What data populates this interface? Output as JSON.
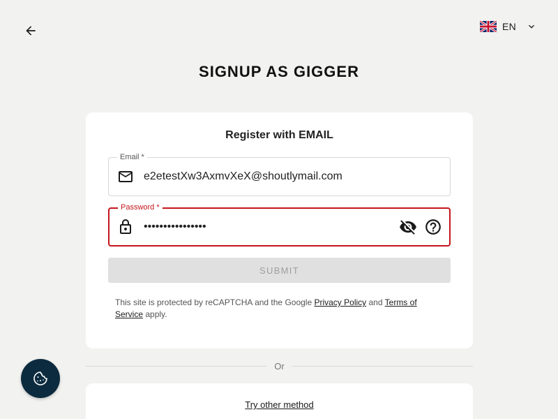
{
  "header": {
    "back_icon": "arrow-left-icon",
    "language": {
      "code": "EN",
      "flag_icon": "uk-flag-icon",
      "chevron_icon": "chevron-down-icon"
    }
  },
  "title": "SIGNUP AS GIGGER",
  "form": {
    "heading": "Register with EMAIL",
    "email": {
      "label": "Email *",
      "value": "e2etestXw3AxmvXeX@shoutlymail.com",
      "icon": "mail-icon"
    },
    "password": {
      "label": "Password *",
      "value": "••••••••••••••••",
      "icon": "lock-icon",
      "visibility_icon": "eye-off-icon",
      "help_icon": "help-circle-icon"
    },
    "submit_label": "SUBMIT",
    "captcha": {
      "prefix": "This site is protected by reCAPTCHA and the Google ",
      "privacy_link": "Privacy Policy",
      "middle": " and ",
      "terms_link": "Terms of Service",
      "suffix": " apply."
    }
  },
  "divider_label": "Or",
  "alternative": {
    "link": "Try other method"
  },
  "cookie_button": {
    "icon": "cookie-icon"
  },
  "colors": {
    "background": "#f2f2f0",
    "card": "#ffffff",
    "error": "#c4161c",
    "cookie_button": "#0d2b3e",
    "disabled_button": "#e0e0e0"
  }
}
